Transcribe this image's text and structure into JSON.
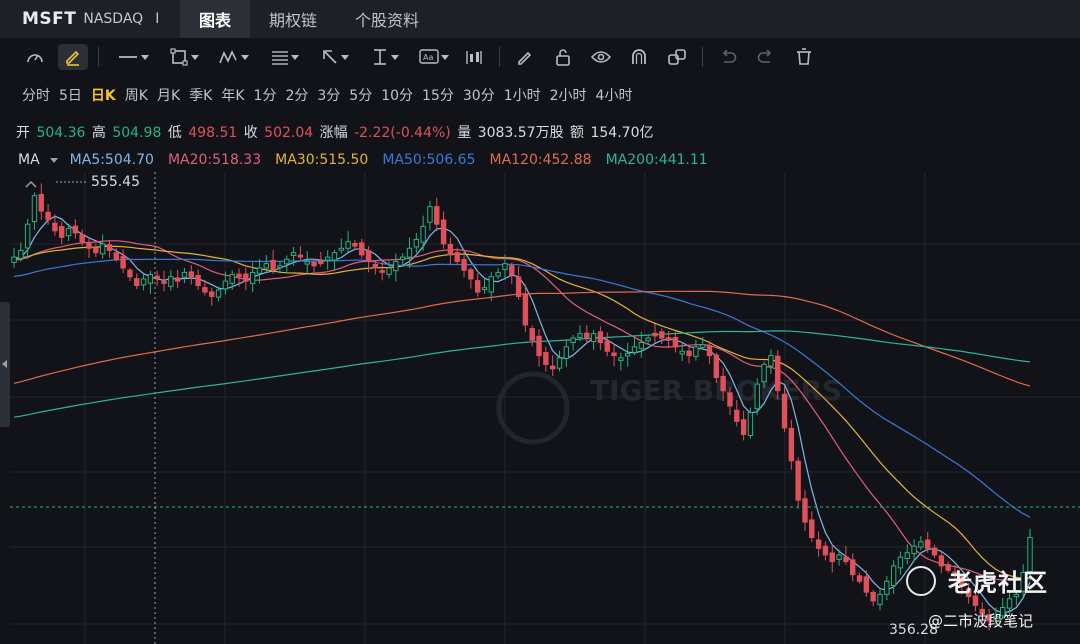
{
  "header": {
    "symbol": "MSFT",
    "exchange": "NASDAQ",
    "separator": "I",
    "tabs": [
      {
        "label": "图表",
        "active": true
      },
      {
        "label": "期权链",
        "active": false
      },
      {
        "label": "个股资料",
        "active": false
      }
    ]
  },
  "toolbar": {
    "icons": [
      "gauge-icon",
      "pencil-highlight-icon",
      "line-tool-icon",
      "rectangle-tool-icon",
      "wave-pattern-icon",
      "fibonacci-icon",
      "arrow-tool-icon",
      "text-cursor-icon",
      "text-box-icon",
      "bar-pattern-icon",
      "eraser-pen-icon",
      "lock-icon",
      "eye-icon",
      "magnet-icon",
      "link-icon",
      "undo-icon",
      "redo-icon",
      "trash-icon"
    ]
  },
  "periods": [
    "分时",
    "5日",
    "日K",
    "周K",
    "月K",
    "季K",
    "年K",
    "1分",
    "2分",
    "3分",
    "5分",
    "10分",
    "15分",
    "30分",
    "1小时",
    "2小时",
    "4小时"
  ],
  "active_period": "日K",
  "quote": {
    "open_label": "开",
    "open": "504.36",
    "high_label": "高",
    "high": "504.98",
    "low_label": "低",
    "low": "498.51",
    "close_label": "收",
    "close": "502.04",
    "change_label": "涨幅",
    "change": "-2.22(-0.44%)",
    "volume_label": "量",
    "volume": "3083.57万股",
    "amount_label": "额",
    "amount": "154.70亿"
  },
  "ma_legend": {
    "label": "MA",
    "items": [
      {
        "text": "MA5:504.70",
        "color": "#7fb8e6"
      },
      {
        "text": "MA20:518.33",
        "color": "#e05f7c"
      },
      {
        "text": "MA30:515.50",
        "color": "#e2b43c"
      },
      {
        "text": "MA50:506.65",
        "color": "#3a78d6"
      },
      {
        "text": "MA120:452.88",
        "color": "#e06a4e"
      },
      {
        "text": "MA200:441.11",
        "color": "#2fb29a"
      }
    ]
  },
  "chart_data": {
    "type": "candlestick",
    "max_label": "555.45",
    "min_label": "356.28",
    "up_color": "#26b37e",
    "down_color": "#e0505a",
    "grid": true,
    "closes": [
      523,
      526,
      538,
      551,
      544,
      540,
      535,
      532,
      536,
      534,
      530,
      527,
      525,
      529,
      526,
      522,
      518,
      514,
      510,
      513,
      515,
      513,
      511,
      514,
      512,
      516,
      514,
      510,
      507,
      505,
      508,
      512,
      515,
      514,
      512,
      516,
      518,
      520,
      517,
      519,
      522,
      525,
      523,
      521,
      519,
      520,
      523,
      525,
      527,
      530,
      528,
      524,
      521,
      518,
      516,
      518,
      521,
      523,
      527,
      531,
      537,
      546,
      538,
      529,
      524,
      521,
      517,
      513,
      507,
      509,
      514,
      516,
      520,
      515,
      505,
      492,
      485,
      478,
      474,
      472,
      477,
      482,
      486,
      488,
      486,
      488,
      484,
      480,
      478,
      477,
      479,
      482,
      484,
      486,
      487,
      486,
      485,
      482,
      480,
      478,
      482,
      483,
      478,
      468,
      462,
      455,
      448,
      442,
      452,
      465,
      474,
      478,
      462,
      445,
      430,
      412,
      402,
      395,
      390,
      387,
      384,
      387,
      384,
      378,
      375,
      370,
      366,
      369,
      375,
      382,
      386,
      388,
      391,
      393,
      390,
      387,
      382,
      380,
      378,
      373,
      368,
      364,
      360,
      357,
      359,
      363,
      367,
      369,
      379,
      395
    ]
  },
  "watermark": "TIGER BROKERS",
  "brand": {
    "name": "老虎社区",
    "author": "@二市波段笔记"
  }
}
